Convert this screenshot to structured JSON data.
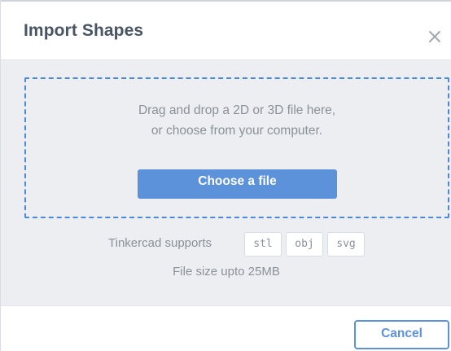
{
  "dialog": {
    "title": "Import Shapes",
    "close_icon": "close-icon"
  },
  "dropzone": {
    "line1": "Drag and drop a 2D or 3D file here,",
    "line2": "or choose from your computer.",
    "choose_label": "Choose a file"
  },
  "supports": {
    "label": "Tinkercad supports",
    "formats": [
      "stl",
      "obj",
      "svg"
    ]
  },
  "filesize_text": "File size upto 25MB",
  "footer": {
    "cancel_label": "Cancel"
  },
  "colors": {
    "accent": "#5b92d9",
    "dashed_border": "#4a8ad6",
    "title_text": "#4a5563",
    "muted_text": "#8b9199",
    "body_bg": "#eceef1"
  }
}
